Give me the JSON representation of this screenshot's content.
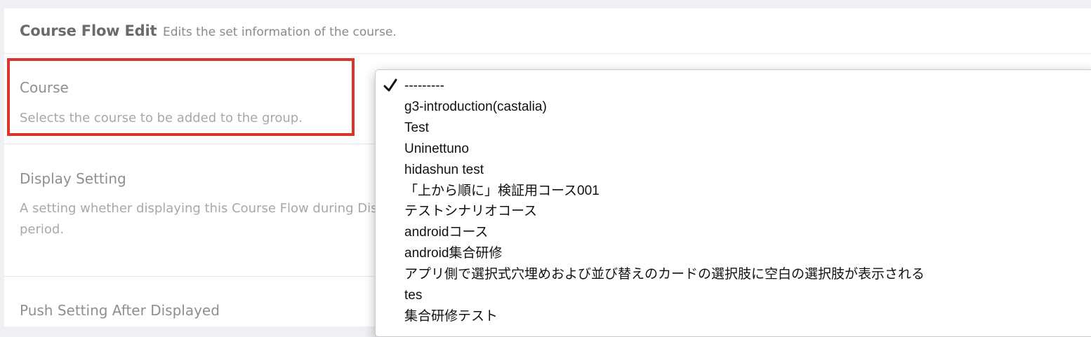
{
  "header": {
    "title": "Course Flow Edit",
    "subtitle": "Edits the set information of the course."
  },
  "course": {
    "label": "Course",
    "description": "Selects the course to be added to the group."
  },
  "display_setting": {
    "label": "Display Setting",
    "description_line1": "A setting whether displaying this Course Flow during Disp",
    "description_line2": "period."
  },
  "push_setting": {
    "label": "Push Setting After Displayed"
  },
  "dropdown": {
    "selected_index": 0,
    "options": [
      "---------",
      "g3-introduction(castalia)",
      "Test",
      "Uninettuno",
      "hidashun test",
      "「上から順に」検証用コース001",
      "テストシナリオコース",
      "androidコース",
      "android集合研修",
      "アプリ側で選択式穴埋めおよび並び替えのカードの選択肢に空白の選択肢が表示される",
      "tes",
      "集合研修テスト"
    ]
  },
  "colors": {
    "highlight_border": "#d9352a",
    "page_background": "#eff0f4"
  }
}
